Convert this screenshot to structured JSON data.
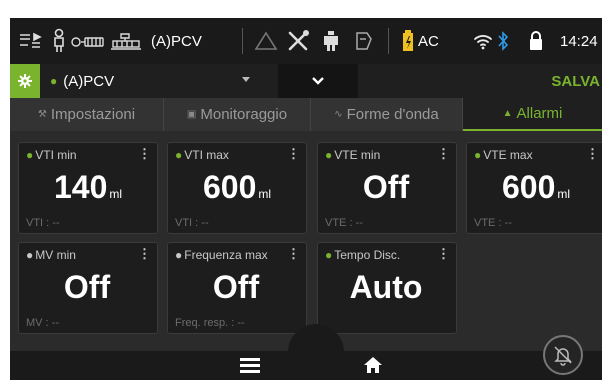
{
  "status_bar": {
    "mode": "(A)PCV",
    "power": "AC",
    "time": "14:24",
    "icons": [
      "hose-icon",
      "patient-adult-icon",
      "humidifier-icon",
      "nebulizer-icon",
      "warning-triangle-icon",
      "tools-icon",
      "patient-connection-icon",
      "o2-sensor-icon",
      "battery-icon",
      "wifi-icon",
      "bluetooth-icon",
      "lock-icon"
    ]
  },
  "mode_bar": {
    "mode_label": "(A)PCV",
    "save_label": "SALVA"
  },
  "tabs": [
    {
      "label": "Impostazioni",
      "icon": "wrench-icon",
      "active": false
    },
    {
      "label": "Monitoraggio",
      "icon": "monitor-icon",
      "active": false
    },
    {
      "label": "Forme d'onda",
      "icon": "waveform-icon",
      "active": false
    },
    {
      "label": "Allarmi",
      "icon": "bell-icon",
      "active": true
    }
  ],
  "alarm_cards": [
    {
      "title": "VTI min",
      "value": "140",
      "unit": "ml",
      "footer": "VTI : --"
    },
    {
      "title": "VTI max",
      "value": "600",
      "unit": "ml",
      "footer": "VTI : --"
    },
    {
      "title": "VTE min",
      "value": "Off",
      "unit": "",
      "footer": "VTE : --"
    },
    {
      "title": "VTE max",
      "value": "600",
      "unit": "ml",
      "footer": "VTE : --"
    },
    {
      "title": "MV min",
      "value": "Off",
      "unit": "",
      "footer": "MV : --"
    },
    {
      "title": "Frequenza max",
      "value": "Off",
      "unit": "",
      "footer": "Freq. resp. : --"
    },
    {
      "title": "Tempo Disc.",
      "value": "Auto",
      "unit": "",
      "footer": ""
    }
  ],
  "colors": {
    "accent_green": "#7ab32e",
    "background": "#2b2b2b",
    "card": "#1d1d1d",
    "battery": "#f0c020",
    "bluetooth": "#2f9be8"
  }
}
